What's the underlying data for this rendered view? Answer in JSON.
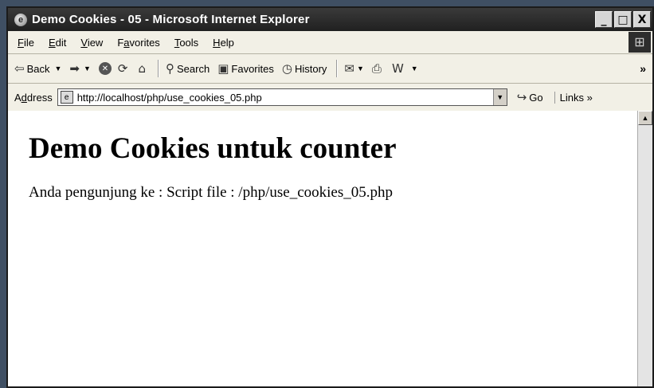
{
  "window": {
    "title": "Demo Cookies - 05 - Microsoft Internet Explorer",
    "controls": [
      "_",
      "□",
      "X"
    ]
  },
  "menu": {
    "items": [
      {
        "key": "F",
        "rest": "ile"
      },
      {
        "key": "E",
        "rest": "dit"
      },
      {
        "key": "V",
        "rest": "iew"
      },
      {
        "pre": "F",
        "key": "a",
        "rest": "vorites"
      },
      {
        "key": "T",
        "rest": "ools"
      },
      {
        "key": "H",
        "rest": "elp"
      }
    ]
  },
  "toolbar": {
    "back_label": "Back",
    "search_label": "Search",
    "favorites_label": "Favorites",
    "history_label": "History",
    "more_label": "»"
  },
  "address": {
    "label_pre": "A",
    "label_key": "d",
    "label_rest": "dress",
    "url": "http://localhost/php/use_cookies_05.php",
    "go_label": "Go",
    "links_label": "Links »"
  },
  "page": {
    "heading": "Demo Cookies untuk counter",
    "line": "Anda pengunjung ke : Script file : /php/use_cookies_05.php"
  },
  "icons": {
    "title_icon": "ie-page-icon",
    "logo": "windows-logo-icon"
  }
}
